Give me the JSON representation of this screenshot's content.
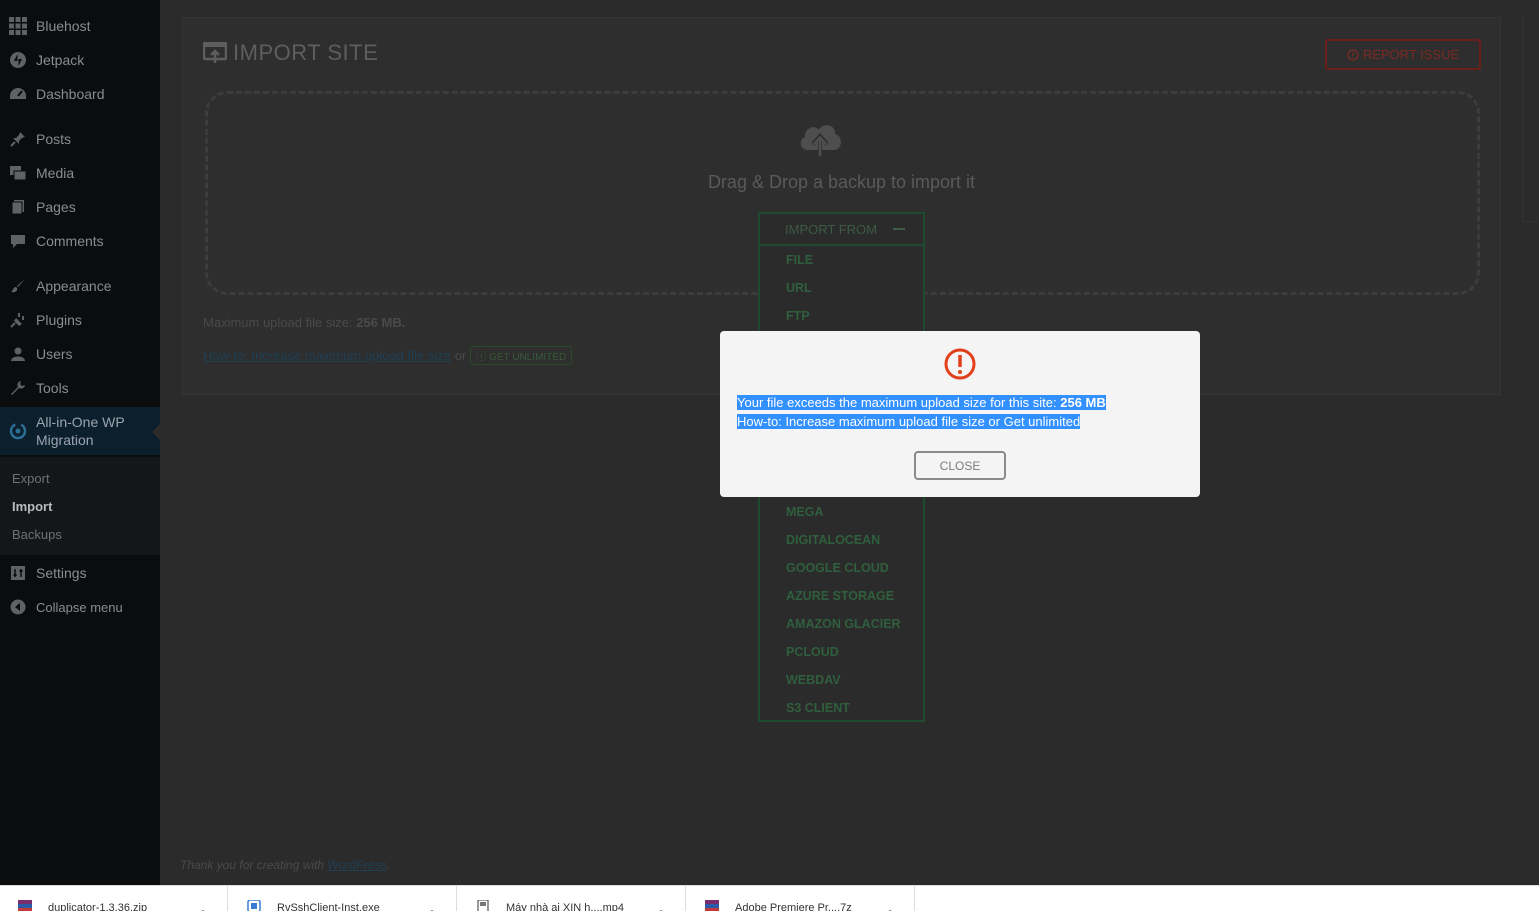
{
  "sidebar": {
    "items": [
      {
        "label": "Bluehost",
        "icon": "grid-icon"
      },
      {
        "label": "Jetpack",
        "icon": "jetpack-icon"
      },
      {
        "label": "Dashboard",
        "icon": "dashboard-icon"
      },
      {
        "label": "Posts",
        "icon": "pin-icon"
      },
      {
        "label": "Media",
        "icon": "media-icon"
      },
      {
        "label": "Pages",
        "icon": "pages-icon"
      },
      {
        "label": "Comments",
        "icon": "comment-icon"
      },
      {
        "label": "Appearance",
        "icon": "brush-icon"
      },
      {
        "label": "Plugins",
        "icon": "plugin-icon"
      },
      {
        "label": "Users",
        "icon": "user-icon"
      },
      {
        "label": "Tools",
        "icon": "wrench-icon"
      }
    ],
    "current": {
      "label_line1": "All-in-One WP",
      "label_line2": "Migration",
      "icon": "migration-icon"
    },
    "submenu": [
      "Export",
      "Import",
      "Backups"
    ],
    "settings": "Settings",
    "collapse": "Collapse menu"
  },
  "main": {
    "title": "IMPORT SITE",
    "report_issue": "REPORT ISSUE",
    "drop_text": "Drag & Drop a backup to import it",
    "max_upload_label": "Maximum upload file size:",
    "max_upload_value": "256 MB.",
    "howto_link": "How-to: Increase maximum upload file size",
    "or_text": "or",
    "get_unlimited": "GET UNLIMITED"
  },
  "import_from": {
    "label": "IMPORT FROM",
    "options_top": [
      "FILE",
      "URL",
      "FTP"
    ],
    "options_bottom": [
      "MEGA",
      "DIGITALOCEAN",
      "GOOGLE CLOUD",
      "AZURE STORAGE",
      "AMAZON GLACIER",
      "PCLOUD",
      "WEBDAV",
      "S3 CLIENT"
    ]
  },
  "modal": {
    "line1_prefix": "Your file exceeds the maximum upload size for this site: ",
    "line1_value": "256 MB",
    "line2": "How-to: Increase maximum upload file size or Get unlimited",
    "close": "CLOSE",
    "error_color": "#e2401c"
  },
  "footer": {
    "prefix": "Thank you for creating with ",
    "link": "WordPress",
    "suffix": "."
  },
  "downloads": [
    {
      "name": "duplicator-1.3.36.zip"
    },
    {
      "name": "RvSshClient-Inst.exe"
    },
    {
      "name": "Máy nhà ai XIN h....mp4"
    },
    {
      "name": "Adobe Premiere Pr....7z"
    }
  ]
}
